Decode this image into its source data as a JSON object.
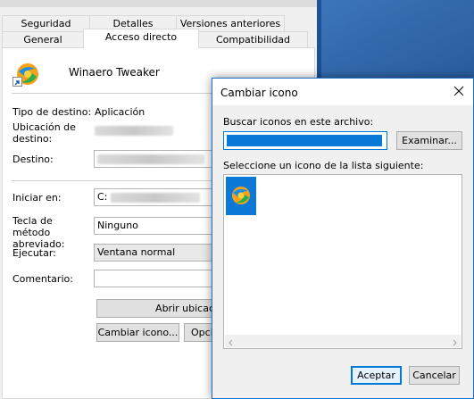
{
  "properties_window": {
    "tabs_row1": [
      "Seguridad",
      "Detalles",
      "Versiones anteriores"
    ],
    "tabs_row2": [
      "General",
      "Acceso directo",
      "Compatibilidad"
    ],
    "app_name": "Winaero Tweaker",
    "labels": {
      "target_type": "Tipo de destino:",
      "target_location": "Ubicación de destino:",
      "target": "Destino:",
      "start_in": "Iniciar en:",
      "shortcut_key": "Tecla de método abreviado:",
      "run": "Ejecutar:",
      "comment": "Comentario:"
    },
    "values": {
      "target_type": "Aplicación",
      "start_in": "C:",
      "shortcut_key": "Ninguno",
      "run": "Ventana normal",
      "comment": ""
    },
    "buttons": {
      "open_location": "Abrir ubicac",
      "change_icon": "Cambiar icono...",
      "advanced": "Opci"
    }
  },
  "dialog": {
    "title": "Cambiar icono",
    "search_label": "Buscar iconos en este archivo:",
    "browse_button": "Examinar...",
    "select_label": "Seleccione un icono de la lista siguiente:",
    "ok_button": "Aceptar",
    "cancel_button": "Cancelar"
  },
  "colors": {
    "accent": "#0078d7",
    "desktop": "#1d5fa8"
  }
}
